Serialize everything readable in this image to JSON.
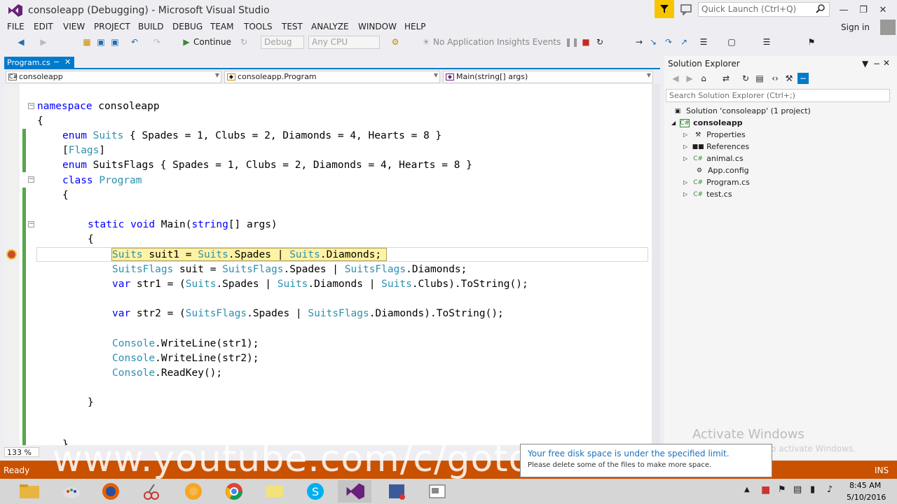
{
  "window": {
    "title": "consoleapp (Debugging) - Microsoft Visual Studio",
    "quick_launch_placeholder": "Quick Launch (Ctrl+Q)",
    "sign_in": "Sign in"
  },
  "menu": [
    "FILE",
    "EDIT",
    "VIEW",
    "PROJECT",
    "BUILD",
    "DEBUG",
    "TEAM",
    "TOOLS",
    "TEST",
    "ANALYZE",
    "WINDOW",
    "HELP"
  ],
  "toolbar": {
    "continue": "Continue",
    "config": "Debug",
    "platform": "Any CPU",
    "insights": "No Application Insights Events"
  },
  "editor": {
    "tab": "Program.cs",
    "nav_project": "consoleapp",
    "nav_class": "consoleapp.Program",
    "nav_member": "Main(string[] args)",
    "zoom": "133 %"
  },
  "code": {
    "l1a": "namespace",
    "l1b": " consoleapp",
    "l2": "{",
    "l3a": "enum",
    "l3b": "Suits",
    "l3c": " { Spades = 1, Clubs = 2, Diamonds = 4, Hearts = 8 }",
    "l4a": "[",
    "l4b": "Flags",
    "l4c": "]",
    "l5a": "enum",
    "l5b": " SuitsFlags { Spades = 1, Clubs = 2, Diamonds = 4, Hearts = 8 }",
    "l6a": "class",
    "l6b": "Program",
    "l7": "{",
    "l8a": "static",
    "l8b": "void",
    "l8c": " Main(",
    "l8d": "string",
    "l8e": "[] args)",
    "l9": "{",
    "l10a": "Suits",
    "l10b": " suit1 = ",
    "l10c": "Suits",
    "l10d": ".Spades | ",
    "l10e": "Suits",
    "l10f": ".Diamonds;",
    "l11a": "SuitsFlags",
    "l11b": " suit = ",
    "l11c": "SuitsFlags",
    "l11d": ".Spades | ",
    "l11e": "SuitsFlags",
    "l11f": ".Diamonds;",
    "l12a": "var",
    "l12b": " str1 = (",
    "l12c": "Suits",
    "l12d": ".Spades | ",
    "l12e": "Suits",
    "l12f": ".Diamonds | ",
    "l12g": "Suits",
    "l12h": ".Clubs).ToString();",
    "l13a": "var",
    "l13b": " str2 = (",
    "l13c": "SuitsFlags",
    "l13d": ".Spades | ",
    "l13e": "SuitsFlags",
    "l13f": ".Diamonds).ToString();",
    "l14a": "Console",
    "l14b": ".WriteLine(str1);",
    "l15a": "Console",
    "l15b": ".WriteLine(str2);",
    "l16a": "Console",
    "l16b": ".ReadKey();",
    "l17": "}",
    "l18": "}"
  },
  "solution_explorer": {
    "title": "Solution Explorer",
    "search_placeholder": "Search Solution Explorer (Ctrl+;)",
    "solution": "Solution 'consoleapp' (1 project)",
    "project": "consoleapp",
    "items": [
      "Properties",
      "References",
      "animal.cs",
      "App.config",
      "Program.cs",
      "test.cs"
    ]
  },
  "status": {
    "ready": "Ready",
    "ins": "INS"
  },
  "watermark": "www.youtube.com/c/gotoreftutorials",
  "activate": {
    "title": "Activate Windows",
    "sub": "Go to PC settings to activate Windows."
  },
  "notification": {
    "line1": "Your free disk space is under the specified limit.",
    "line2": "Please delete some of the files to make more space."
  },
  "clock": {
    "time": "8:45 AM",
    "date": "5/10/2016"
  },
  "colors": {
    "accent": "#007acc",
    "status": "#ca5100",
    "keyword": "#0000ff",
    "type": "#2b91af"
  }
}
